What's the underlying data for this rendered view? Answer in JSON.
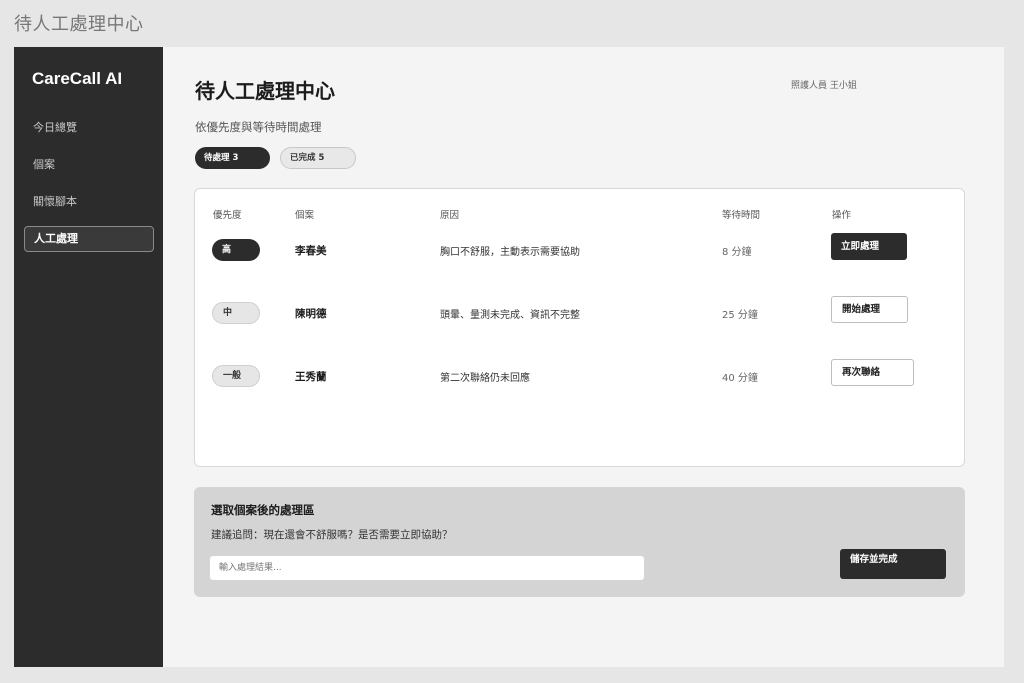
{
  "window": {
    "title": "待人工處理中心"
  },
  "sidebar": {
    "brand": "CareCall AI",
    "items": [
      {
        "label": "今日總覽",
        "active": false
      },
      {
        "label": "個案",
        "active": false
      },
      {
        "label": "關懷腳本",
        "active": false
      },
      {
        "label": "人工處理",
        "active": true
      }
    ]
  },
  "header": {
    "title": "待人工處理中心",
    "staff": "照護人員 王小姐",
    "subtitle": "依優先度與等待時間處理"
  },
  "filters": [
    {
      "label": "待處理 3",
      "active": true
    },
    {
      "label": "已完成 5",
      "active": false
    }
  ],
  "table": {
    "headers": {
      "priority": "優先度",
      "case": "個案",
      "reason": "原因",
      "wait": "等待時間",
      "action": "操作"
    },
    "rows": [
      {
        "priority": "高",
        "name": "李春美",
        "reason": "胸口不舒服，主動表示需要協助",
        "wait": "8 分鐘",
        "action": "立即處理",
        "style": "dark"
      },
      {
        "priority": "中",
        "name": "陳明德",
        "reason": "頭暈、量測未完成、資訊不完整",
        "wait": "25 分鐘",
        "action": "開始處理",
        "style": "light"
      },
      {
        "priority": "一般",
        "name": "王秀蘭",
        "reason": "第二次聯絡仍未回應",
        "wait": "40 分鐘",
        "action": "再次聯絡",
        "style": "light"
      }
    ]
  },
  "panel": {
    "title": "選取個案後的處理區",
    "hint": "建議追問：現在還會不舒服嗎？是否需要立即協助？",
    "input_placeholder": "輸入處理結果...",
    "input_value": "",
    "save_label": "儲存並完成"
  }
}
